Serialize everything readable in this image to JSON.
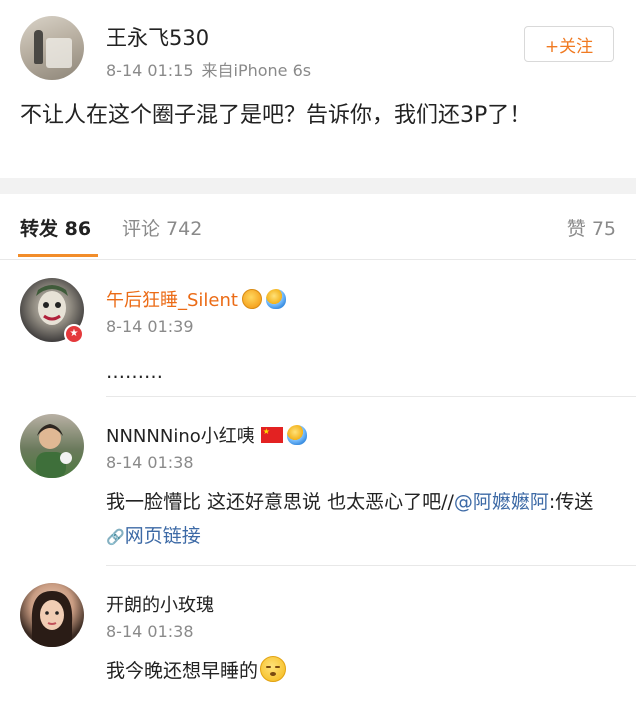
{
  "post": {
    "author": "王永飞530",
    "time": "8-14 01:15",
    "source": "来自iPhone 6s",
    "follow_label": "+关注",
    "text": "不让人在这个圈子混了是吧？告诉你，我们还3P了！"
  },
  "tabs": {
    "repost": "转发 86",
    "comment": "评论 742",
    "like": "赞 75"
  },
  "comments": [
    {
      "name": "午后狂睡_Silent",
      "time": "8-14 01:39",
      "text": "………",
      "badges": [
        "vip-icon",
        "balloon-icon"
      ],
      "name_color": "#eb6b16"
    },
    {
      "name": "NNNNNino小红咦",
      "time": "8-14 01:38",
      "text_before": "我一脸懵比 这还好意思说 也太恶心了吧//",
      "mention": "@阿嬷嬷阿",
      "text_mid": ":传送 ",
      "link_icon": "link-icon",
      "link_text": "网页链接",
      "badges": [
        "china-flag-icon",
        "balloon-icon"
      ]
    },
    {
      "name": "开朗的小玫瑰",
      "time": "8-14 01:38",
      "text": "我今晚还想早睡的",
      "emoji": "sleepy-emoji"
    }
  ],
  "colors": {
    "accent": "#f07a22",
    "link": "#3d6aa6",
    "meta": "#8a8a8a",
    "tab_indicator": "#f28d2a"
  }
}
